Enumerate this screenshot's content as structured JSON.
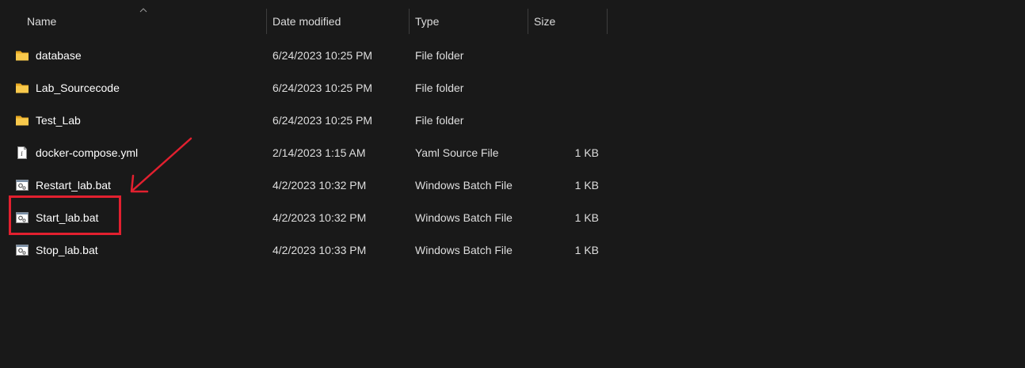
{
  "columns": {
    "name": "Name",
    "date": "Date modified",
    "type": "Type",
    "size": "Size"
  },
  "files": [
    {
      "name": "database",
      "date": "6/24/2023 10:25 PM",
      "type": "File folder",
      "size": "",
      "icon": "folder-icon"
    },
    {
      "name": "Lab_Sourcecode",
      "date": "6/24/2023 10:25 PM",
      "type": "File folder",
      "size": "",
      "icon": "folder-icon"
    },
    {
      "name": "Test_Lab",
      "date": "6/24/2023 10:25 PM",
      "type": "File folder",
      "size": "",
      "icon": "folder-icon"
    },
    {
      "name": "docker-compose.yml",
      "date": "2/14/2023 1:15 AM",
      "type": "Yaml Source File",
      "size": "1 KB",
      "icon": "yaml-file-icon"
    },
    {
      "name": "Restart_lab.bat",
      "date": "4/2/2023 10:32 PM",
      "type": "Windows Batch File",
      "size": "1 KB",
      "icon": "batch-file-icon"
    },
    {
      "name": "Start_lab.bat",
      "date": "4/2/2023 10:32 PM",
      "type": "Windows Batch File",
      "size": "1 KB",
      "icon": "batch-file-icon"
    },
    {
      "name": "Stop_lab.bat",
      "date": "4/2/2023 10:33 PM",
      "type": "Windows Batch File",
      "size": "1 KB",
      "icon": "batch-file-icon"
    }
  ],
  "annotation": {
    "highlighted_file": "Start_lab.bat",
    "color": "#e2202f"
  },
  "colors": {
    "background": "#191919",
    "folder": "#f4c14a"
  }
}
